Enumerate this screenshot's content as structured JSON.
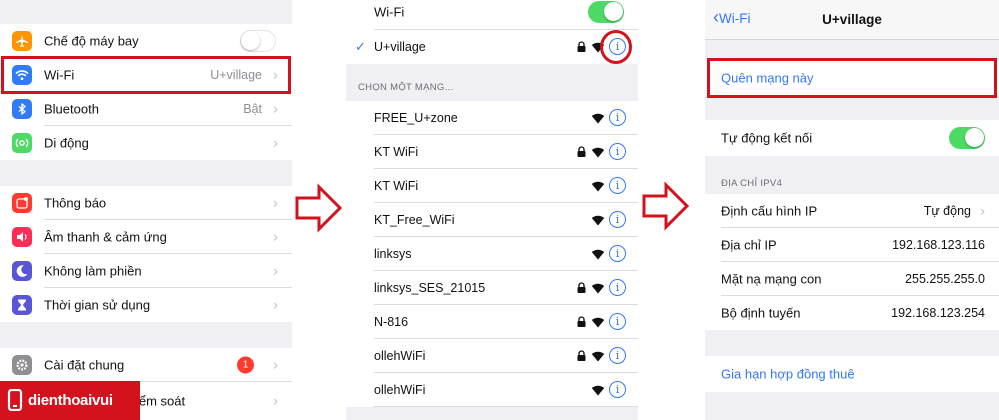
{
  "settings": {
    "airplane_label": "Chế độ máy bay",
    "wifi_label": "Wi-Fi",
    "wifi_value": "U+village",
    "bluetooth_label": "Bluetooth",
    "bluetooth_value": "Bật",
    "cellular_label": "Di động",
    "notifications_label": "Thông báo",
    "sounds_label": "Âm thanh & cảm ứng",
    "dnd_label": "Không làm phiền",
    "screentime_label": "Thời gian sử dụng",
    "general_label": "Cài đặt chung",
    "general_badge": "1",
    "control_label": "iểm soát"
  },
  "wifi_list": {
    "wifi_label": "Wi-Fi",
    "connected_network": "U+village",
    "choose_header": "CHỌN MỘT MẠNG...",
    "networks": [
      {
        "name": "FREE_U+zone",
        "locked": false
      },
      {
        "name": "KT WiFi",
        "locked": true
      },
      {
        "name": "KT WiFi",
        "locked": false
      },
      {
        "name": "KT_Free_WiFi",
        "locked": false
      },
      {
        "name": "linksys",
        "locked": false
      },
      {
        "name": "linksys_SES_21015",
        "locked": true
      },
      {
        "name": "N-816",
        "locked": true
      },
      {
        "name": "ollehWiFi",
        "locked": true
      },
      {
        "name": "ollehWiFi",
        "locked": false
      }
    ],
    "info_glyph": "i"
  },
  "network_detail": {
    "back_label": "Wi-Fi",
    "title": "U+village",
    "forget_label": "Quên mạng này",
    "auto_join_label": "Tự động kết nối",
    "ipv4_header": "ĐỊA CHỈ IPV4",
    "configure_ip_label": "Định cấu hình IP",
    "configure_ip_value": "Tự động",
    "ip_label": "Địa chỉ IP",
    "ip_value": "192.168.123.116",
    "subnet_label": "Mặt nạ mạng con",
    "subnet_value": "255.255.255.0",
    "router_label": "Bộ định tuyến",
    "router_value": "192.168.123.254",
    "renew_lease_label": "Gia hạn hợp đồng thuê"
  },
  "logo": {
    "text": "dienthoaivui"
  },
  "colors": {
    "accent": "#3478f6",
    "highlight": "#d4121e",
    "toggle_on": "#4cd964",
    "airplane": "#ff9500",
    "wifi": "#2f7cf6",
    "bluetooth": "#2f7cf6",
    "cellular": "#4cd964",
    "notifications": "#ff3b30",
    "sounds": "#ff2d55",
    "dnd": "#5856d6",
    "screentime": "#5856d6",
    "general": "#8e8e93"
  }
}
